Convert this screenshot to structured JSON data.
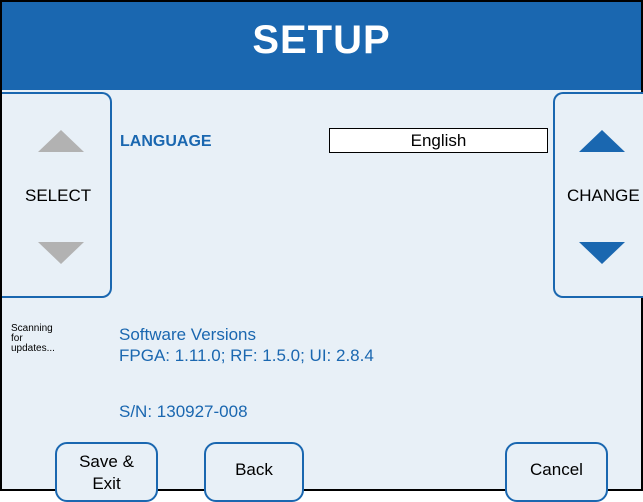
{
  "header": {
    "title": "SETUP"
  },
  "select_panel": {
    "label": "SELECT",
    "up_icon": "triangle-up-icon",
    "down_icon": "triangle-down-icon",
    "arrow_color": "#b2b2b2"
  },
  "change_panel": {
    "label": "CHANGE",
    "up_icon": "triangle-up-icon",
    "down_icon": "triangle-down-icon",
    "arrow_color": "#1a67b0"
  },
  "setting": {
    "label": "LANGUAGE",
    "value": "English"
  },
  "status": {
    "line1": "Scanning",
    "line2": "for",
    "line3": "updates..."
  },
  "info": {
    "software_heading": "Software Versions",
    "versions": "FPGA: 1.11.0; RF: 1.5.0; UI: 2.8.4",
    "serial": "S/N: 130927-008"
  },
  "buttons": {
    "save_line1": "Save &",
    "save_line2": "Exit",
    "back": "Back",
    "cancel": "Cancel"
  },
  "colors": {
    "accent": "#1a67b0",
    "background": "#e8f0f7"
  }
}
